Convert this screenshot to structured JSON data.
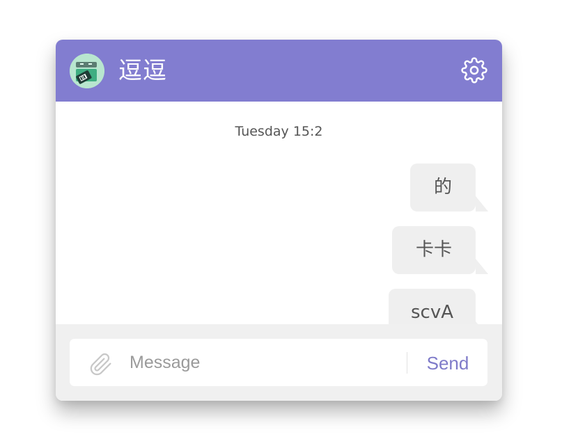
{
  "colors": {
    "header": "#827dd0",
    "accent": "#7f7bc9",
    "bubble": "#efefef",
    "footer": "#f0f0f0"
  },
  "header": {
    "title": "逗逗",
    "avatar_icon": "avatar-icon",
    "settings_icon": "gear-icon"
  },
  "conversation": {
    "timestamp": "Tuesday 15:2",
    "messages": [
      {
        "text": "的",
        "side": "right"
      },
      {
        "text": "卡卡",
        "side": "right"
      },
      {
        "text": "scvA",
        "side": "right"
      }
    ]
  },
  "composer": {
    "attach_icon": "paperclip-icon",
    "placeholder": "Message",
    "value": "",
    "send_label": "Send"
  }
}
